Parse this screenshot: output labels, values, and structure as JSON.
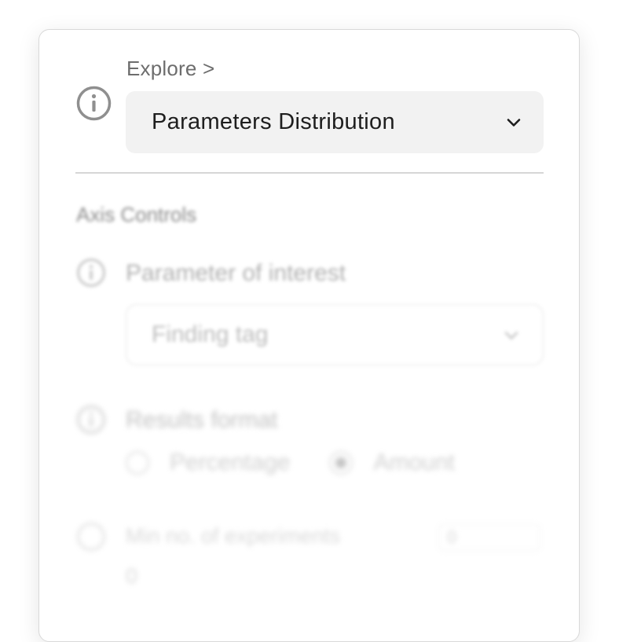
{
  "header": {
    "breadcrumb": "Explore >",
    "view_select": {
      "value": "Parameters Distribution"
    }
  },
  "axis_controls": {
    "section_title": "Axis Controls",
    "parameter_of_interest": {
      "label": "Parameter of interest",
      "value": "Finding tag"
    },
    "results_format": {
      "label": "Results format",
      "options": [
        "Percentage",
        "Amount"
      ],
      "selected": "Amount"
    },
    "min_experiments": {
      "label": "Min no. of experiments",
      "value": "0",
      "field_value": "0"
    }
  },
  "colors": {
    "panel_border": "#d9d9d9",
    "select_background": "#f2f2f2",
    "text_primary": "#1e1e1e",
    "text_muted": "#6d6d6d"
  }
}
